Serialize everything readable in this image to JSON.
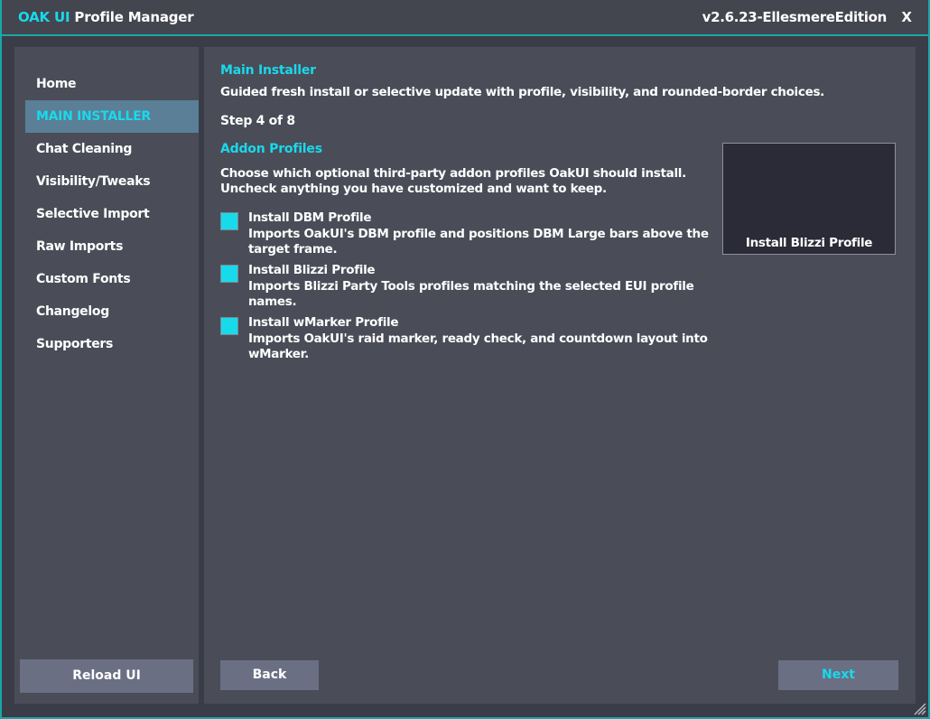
{
  "window": {
    "title_brand": "OAK UI",
    "title_rest": " Profile Manager",
    "version": "v2.6.23-EllesmereEdition",
    "close_label": "X"
  },
  "sidebar": {
    "items": [
      {
        "label": "Home",
        "active": false
      },
      {
        "label": "MAIN INSTALLER",
        "active": true
      },
      {
        "label": "Chat Cleaning",
        "active": false
      },
      {
        "label": "Visibility/Tweaks",
        "active": false
      },
      {
        "label": "Selective Import",
        "active": false
      },
      {
        "label": "Raw Imports",
        "active": false
      },
      {
        "label": "Custom Fonts",
        "active": false
      },
      {
        "label": "Changelog",
        "active": false
      },
      {
        "label": "Supporters",
        "active": false
      }
    ],
    "reload_label": "Reload UI"
  },
  "main": {
    "title": "Main Installer",
    "description": "Guided fresh install or selective update with profile, visibility, and rounded-border choices.",
    "step": "Step 4 of 8",
    "section_title": "Addon Profiles",
    "section_description": "Choose which optional third-party addon profiles OakUI should install. Uncheck anything you have customized and want to keep.",
    "options": [
      {
        "label": "Install DBM Profile",
        "description": "Imports OakUI's DBM profile and positions DBM Large bars above the target frame.",
        "checked": true
      },
      {
        "label": "Install Blizzi Profile",
        "description": "Imports Blizzi Party Tools profiles matching the selected EUI profile names.",
        "checked": true
      },
      {
        "label": "Install wMarker Profile",
        "description": "Imports OakUI's raid marker, ready check, and countdown layout into wMarker.",
        "checked": true
      }
    ],
    "preview_label": "Install Blizzi Profile",
    "back_label": "Back",
    "next_label": "Next"
  },
  "colors": {
    "accent": "#19d9ec",
    "frame_border": "#1aa7a8",
    "panel": "#4a4d58",
    "active_nav": "#5a7f96",
    "button": "#6a6f84"
  },
  "icons": {
    "close": "close-icon",
    "resize": "resize-grip-icon"
  }
}
